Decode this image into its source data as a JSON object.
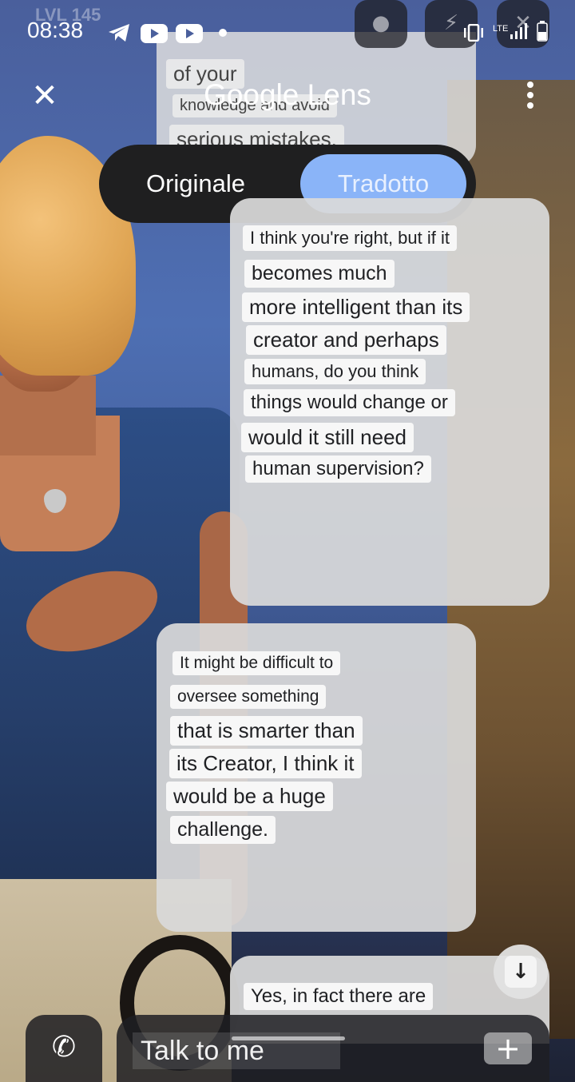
{
  "status_bar": {
    "time": "08:38",
    "network": "LTE",
    "overlay_level": "LVL 145",
    "icons": [
      "telegram-icon",
      "youtube-icon",
      "youtube-icon",
      "dot-icon",
      "vibrate-icon",
      "signal-icon",
      "battery-icon"
    ]
  },
  "lens_bar": {
    "title": "Google Lens",
    "close_icon": "close-icon",
    "menu_icon": "more-vert-icon"
  },
  "toggle": {
    "original_label": "Originale",
    "translated_label": "Tradotto",
    "selected": "Tradotto",
    "selected_color": "#8ab4f8"
  },
  "messages": {
    "top_fragment": [
      "of your",
      "knowledge and avoid",
      "serious mistakes."
    ],
    "user_message": [
      "I think you're right, but if it",
      "becomes much",
      "more intelligent than its",
      "creator and perhaps",
      "humans, do you think",
      "things would change or",
      "would it still need",
      "human supervision?"
    ],
    "bot_message": [
      "It might be difficult to",
      "oversee something",
      "that is smarter than",
      "its Creator, I think it",
      "would be a huge",
      "challenge."
    ],
    "partial_message": [
      "Yes, in fact there are"
    ]
  },
  "input_bar": {
    "placeholder": "Talk to me",
    "call_icon": "phone-icon",
    "plus_label": "+"
  },
  "scroll_icon": "arrow-down-icon"
}
